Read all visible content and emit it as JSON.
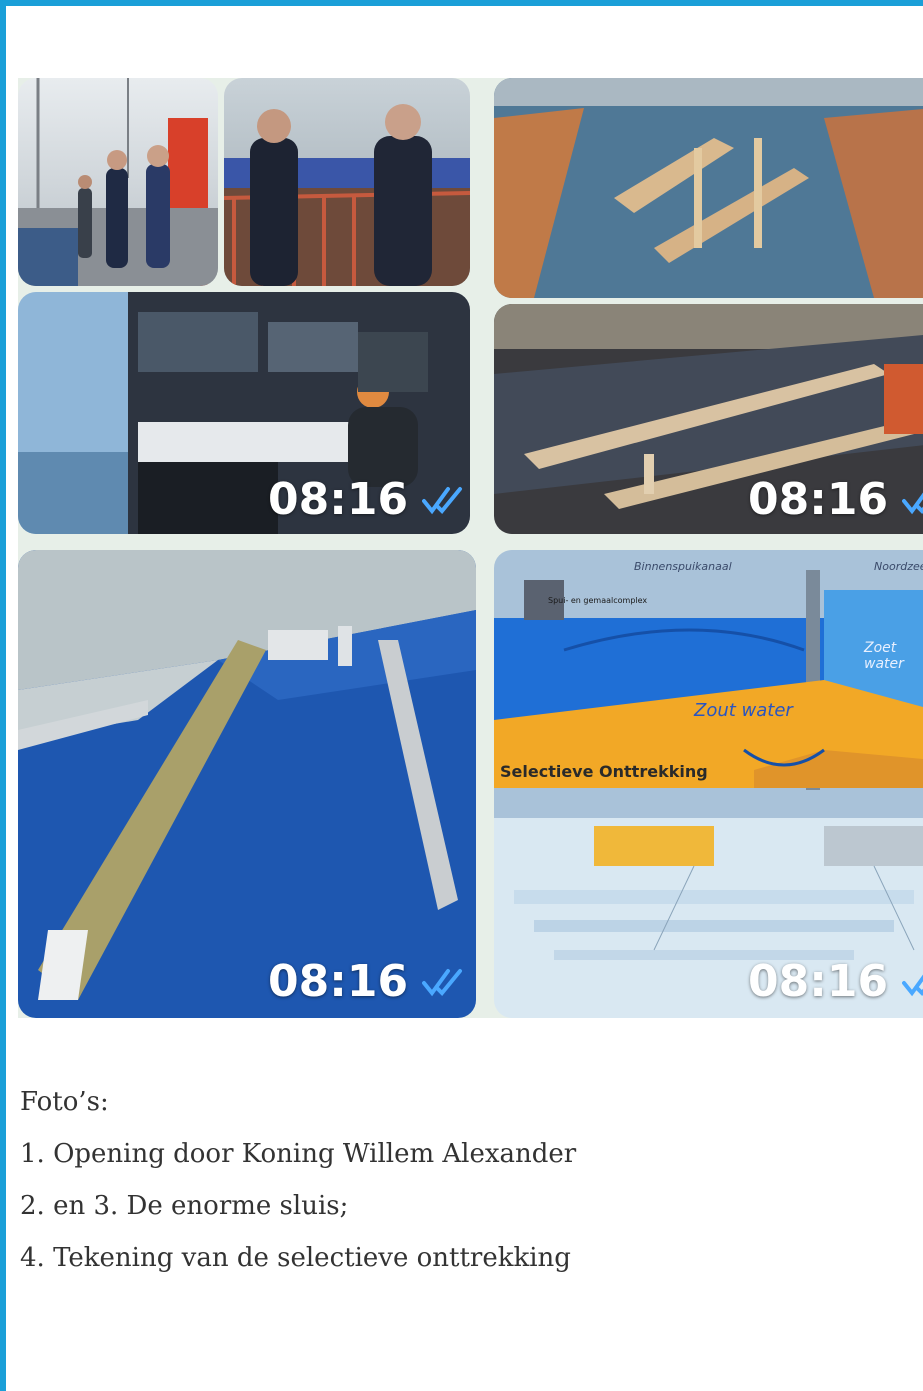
{
  "photos": {
    "timestamp": "08:16",
    "status_icon": "double-check-icon",
    "diagram": {
      "label_top_left": "Binnenspuikanaal",
      "label_top_right": "Noordzee",
      "label_complex": "Spui- en gemaalcomplex",
      "label_salt": "Zout water",
      "label_sea_salt": "Zoet water",
      "label_title": "Selectieve Onttrekking"
    }
  },
  "caption": {
    "heading": "Foto’s:",
    "items": [
      "1. Opening door Koning Willem Alexander",
      "2. en 3. De enorme sluis;",
      "4. Tekening van de selectieve onttrekking"
    ]
  },
  "colors": {
    "frame": "#1a9fd8",
    "ticks": "#4aa8ff",
    "diagram_water": "#1f6fd6",
    "diagram_sand": "#f2a826"
  }
}
